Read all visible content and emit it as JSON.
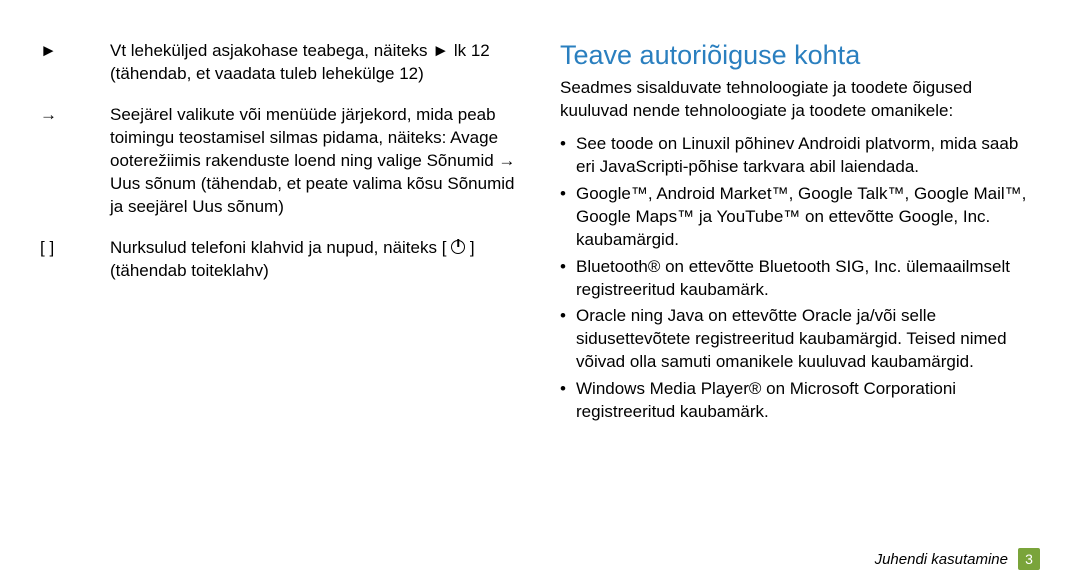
{
  "left": {
    "rows": [
      {
        "sym": "►",
        "text": "Vt leheküljed asjakohase teabega, näiteks ► lk 12 (tähendab, et vaadata tuleb lehekülge 12)"
      },
      {
        "sym": "→",
        "text": "Seejärel valikute või menüüde järjekord, mida peab toimingu teostamisel silmas pidama, näiteks: Avage ooterežiimis rakenduste loend ning valige Sõnumid → Uus sõnum (tähendab, et peate valima kõsu Sõnumid ja seejärel Uus sõnum)"
      },
      {
        "sym": "[    ]",
        "text": "Nurksulud telefoni klahvid ja nupud, näiteks [ ⏻ ] (tähendab toiteklahv)"
      }
    ]
  },
  "right": {
    "title": "Teave autoriõiguse kohta",
    "intro": "Seadmes sisalduvate tehnoloogiate ja toodete õigused kuuluvad nende tehnoloogiate ja toodete omanikele:",
    "bullets": [
      "See toode on Linuxil põhinev Androidi platvorm, mida saab eri JavaScripti-põhise tarkvara abil laiendada.",
      "Google™, Android Market™, Google Talk™, Google Mail™, Google Maps™ ja YouTube™ on ettevõtte Google, Inc. kaubamärgid.",
      "Bluetooth® on ettevõtte Bluetooth SIG, Inc. ülemaailmselt registreeritud kaubamärk.",
      "Oracle ning Java on ettevõtte Oracle ja/või selle sidusettevõtete registreeritud kaubamärgid. Teised nimed võivad olla samuti omanikele kuuluvad kaubamärgid.",
      "Windows Media Player® on Microsoft Corporationi registreeritud kaubamärk."
    ]
  },
  "footer": {
    "section": "Juhendi kasutamine",
    "page": "3"
  }
}
